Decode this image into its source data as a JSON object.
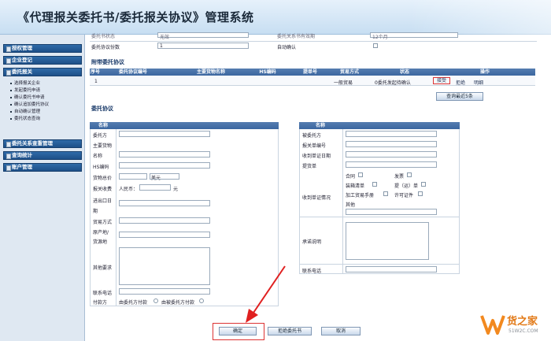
{
  "app": {
    "title": "《代理报关委托书/委托报关协议》管理系统"
  },
  "sidebar": {
    "menus": [
      {
        "label": "授权管理"
      },
      {
        "label": "企业登记"
      },
      {
        "label": "委托报关"
      },
      {
        "label": "委托关系查重管理"
      },
      {
        "label": "查询统计"
      },
      {
        "label": "账户管理"
      }
    ],
    "sub_items": [
      "选择报关企业",
      "发起委托申请",
      "确认委托书申请",
      "确认追加委托协议",
      "自动确认管理",
      "委托状态查询"
    ]
  },
  "top_form": {
    "label1": "委托协议份数",
    "value1": "1",
    "label2": "自动确认",
    "row0_label1": "委托书状态",
    "row0_value1": "无效",
    "row0_label2": "委托关系书有效期",
    "row0_value2": "12个月"
  },
  "attached": {
    "section_title": "附带委托协议",
    "headers": [
      "序号",
      "委托协议编号",
      "主要货物名称",
      "HS编码",
      "提单号",
      "贸易方式",
      "状态",
      "操作"
    ],
    "row": {
      "index": "1",
      "trade": "一般贸易",
      "status": "0委托发起待确认",
      "op_accept": "接受",
      "op_reject": "拒绝",
      "op_detail": "明细"
    },
    "query_button": "查询最近5条"
  },
  "agreement": {
    "section_title": "委托协议",
    "left": {
      "header": "名称",
      "labels": [
        "委托方",
        "主要货物",
        "名称",
        "HS编码",
        "货物总价",
        "报关收费",
        "进出口日",
        "期",
        "贸易方式",
        "原产地/",
        "货源地",
        "其他要求",
        "联系电话",
        "付款方"
      ],
      "currency_usd": "美元",
      "currency_rmb": "人民币：",
      "unit_yuan": "元",
      "pay_opt1": "由委托方付款",
      "pay_opt2": "由被委托方付款"
    },
    "right": {
      "header": "名称",
      "labels": [
        "被委托方",
        "报关单编号",
        "收到单证日期",
        "提货单",
        "收到单证情况",
        "承诺说明",
        "联系电话"
      ],
      "docs": [
        "合同",
        "发票",
        "装箱清单",
        "提（运）单",
        "加工贸易手册",
        "许可证件",
        "其他"
      ]
    }
  },
  "actions": {
    "confirm": "确定",
    "reject": "拒绝委托书",
    "cancel": "取消"
  },
  "watermark": {
    "brand": "货之家",
    "url": "51W2C.COM"
  }
}
